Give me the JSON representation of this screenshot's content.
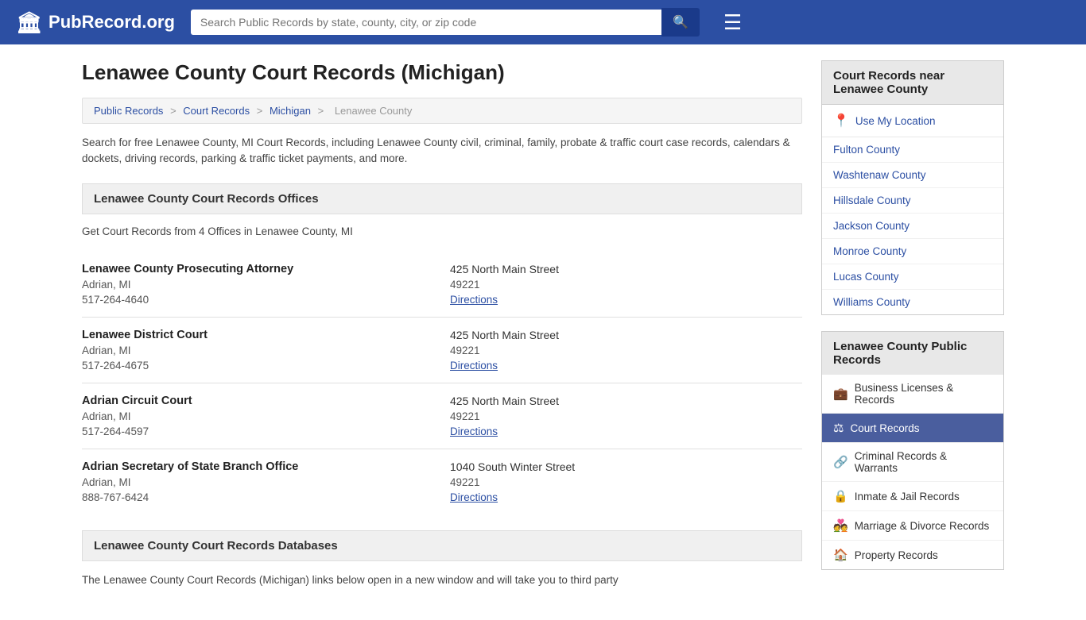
{
  "header": {
    "logo_icon": "🏛",
    "logo_text": "PubRecord.org",
    "search_placeholder": "Search Public Records by state, county, city, or zip code",
    "search_button_icon": "🔍",
    "hamburger_icon": "☰"
  },
  "page": {
    "title": "Lenawee County Court Records (Michigan)",
    "breadcrumb": {
      "items": [
        "Public Records",
        "Court Records",
        "Michigan",
        "Lenawee County"
      ],
      "separators": [
        ">",
        ">",
        ">"
      ]
    },
    "description": "Search for free Lenawee County, MI Court Records, including Lenawee County civil, criminal, family, probate & traffic court case records, calendars & dockets, driving records, parking & traffic ticket payments, and more.",
    "offices_section": {
      "header": "Lenawee County Court Records Offices",
      "subtext": "Get Court Records from 4 Offices in Lenawee County, MI",
      "offices": [
        {
          "name": "Lenawee County Prosecuting Attorney",
          "city": "Adrian, MI",
          "phone": "517-264-4640",
          "address": "425 North Main Street",
          "zip": "49221",
          "directions": "Directions"
        },
        {
          "name": "Lenawee District Court",
          "city": "Adrian, MI",
          "phone": "517-264-4675",
          "address": "425 North Main Street",
          "zip": "49221",
          "directions": "Directions"
        },
        {
          "name": "Adrian Circuit Court",
          "city": "Adrian, MI",
          "phone": "517-264-4597",
          "address": "425 North Main Street",
          "zip": "49221",
          "directions": "Directions"
        },
        {
          "name": "Adrian Secretary of State Branch Office",
          "city": "Adrian, MI",
          "phone": "888-767-6424",
          "address": "1040 South Winter Street",
          "zip": "49221",
          "directions": "Directions"
        }
      ]
    },
    "databases_section": {
      "header": "Lenawee County Court Records Databases",
      "description": "The Lenawee County Court Records (Michigan) links below open in a new window and will take you to third party"
    }
  },
  "sidebar": {
    "nearby_title": "Court Records near Lenawee County",
    "use_location_label": "Use My Location",
    "use_location_icon": "📍",
    "nearby_counties": [
      "Fulton County",
      "Washtenaw County",
      "Hillsdale County",
      "Jackson County",
      "Monroe County",
      "Lucas County",
      "Williams County"
    ],
    "public_records_title": "Lenawee County Public Records",
    "record_links": [
      {
        "label": "Business Licenses & Records",
        "icon": "💼",
        "active": false
      },
      {
        "label": "Court Records",
        "icon": "⚖",
        "active": true
      },
      {
        "label": "Criminal Records & Warrants",
        "icon": "🔗",
        "active": false
      },
      {
        "label": "Inmate & Jail Records",
        "icon": "🔒",
        "active": false
      },
      {
        "label": "Marriage & Divorce Records",
        "icon": "💑",
        "active": false
      },
      {
        "label": "Property Records",
        "icon": "🏠",
        "active": false
      }
    ]
  }
}
